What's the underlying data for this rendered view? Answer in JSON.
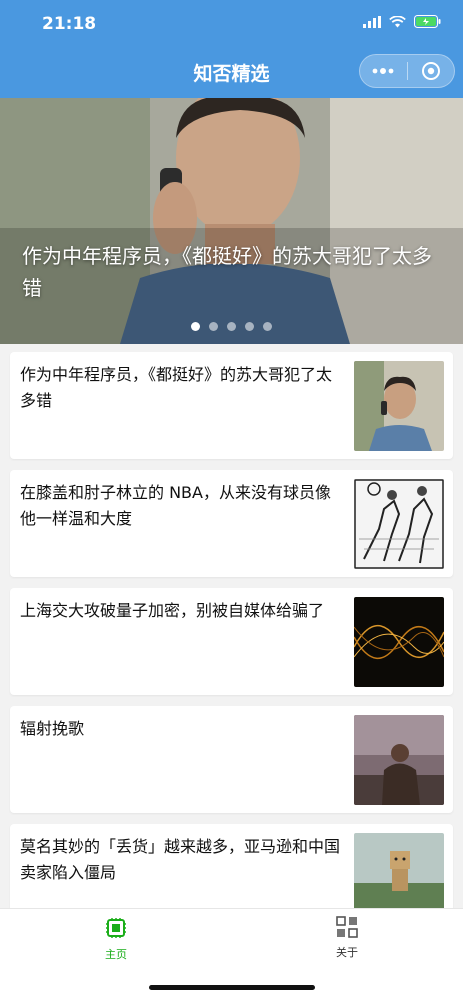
{
  "status_bar": {
    "time": "21:18"
  },
  "nav": {
    "title": "知否精选"
  },
  "banner": {
    "caption": "作为中年程序员，《都挺好》的苏大哥犯了太多错",
    "dot_count": 5,
    "active_dot": 0
  },
  "articles": [
    {
      "title": "作为中年程序员，《都挺好》的苏大哥犯了太多错"
    },
    {
      "title": "在膝盖和肘子林立的 NBA，从来没有球员像他一样温和大度"
    },
    {
      "title": "上海交大攻破量子加密，别被自媒体给骗了"
    },
    {
      "title": "辐射挽歌"
    },
    {
      "title": "莫名其妙的「丢货」越来越多，亚马逊和中国卖家陷入僵局"
    }
  ],
  "tabbar": {
    "home_label": "主页",
    "about_label": "关于",
    "active_color": "#1aad19",
    "inactive_color": "#333333"
  },
  "colors": {
    "nav_bg": "#4a98e0",
    "page_bg": "#f2f2f2"
  }
}
